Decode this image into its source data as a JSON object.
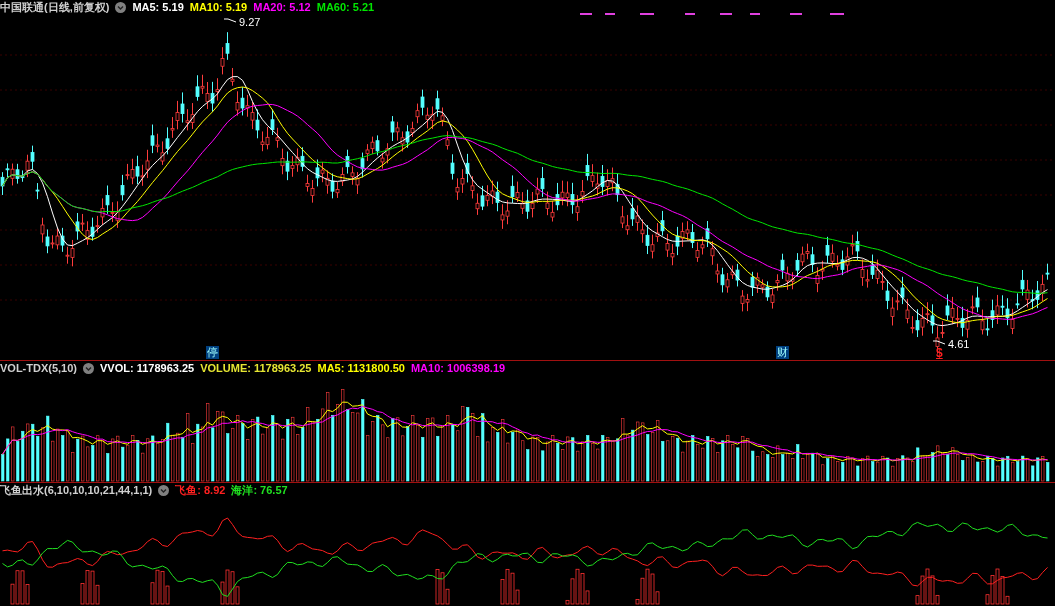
{
  "main_panel": {
    "title": "中国联通(日线,前复权)",
    "indicators": [
      {
        "label": "MA5: 5.19",
        "color": "#ffffff"
      },
      {
        "label": "MA10: 5.19",
        "color": "#ffff00"
      },
      {
        "label": "MA20: 5.12",
        "color": "#ff00ff"
      },
      {
        "label": "MA60: 5.21",
        "color": "#00e600"
      }
    ],
    "high_label": "9.27",
    "low_label": "4.61",
    "markers": [
      {
        "text": "停",
        "kind": "event"
      },
      {
        "text": "财",
        "kind": "event"
      },
      {
        "text": "$",
        "kind": "signal"
      }
    ]
  },
  "volume_panel": {
    "title": "VOL-TDX(5,10)",
    "indicators": [
      {
        "label": "VVOL: 1178963.25",
        "color": "#ffffff"
      },
      {
        "label": "VOLUME: 1178963.25",
        "color": "#e6e632"
      },
      {
        "label": "MA5: 1131800.50",
        "color": "#ffff00"
      },
      {
        "label": "MA10: 1006398.19",
        "color": "#ff00ff"
      }
    ]
  },
  "indicator_panel": {
    "title": "飞鱼出水(6,10,10,10,21,44,1,1)",
    "indicators": [
      {
        "label": "飞鱼: 8.92",
        "color": "#ff2020"
      },
      {
        "label": "海洋: 76.57",
        "color": "#20e020"
      }
    ]
  }
}
